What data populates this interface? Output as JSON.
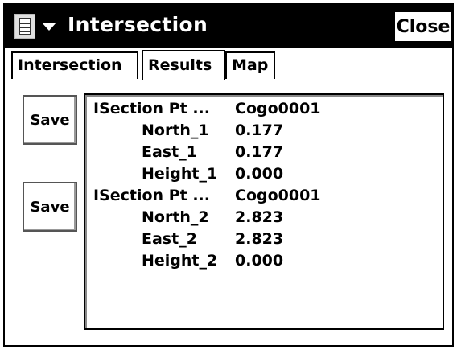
{
  "window": {
    "title": "Intersection",
    "close_label": "Close",
    "menu_icon": "document-menu-icon"
  },
  "tabs": [
    {
      "label": "Intersection",
      "active": false
    },
    {
      "label": "Results",
      "active": true
    },
    {
      "label": "Map",
      "active": false
    }
  ],
  "buttons": {
    "save_1": "Save",
    "save_2": "Save"
  },
  "results": [
    {
      "label": "ISection Pt ...",
      "value": "Cogo0001"
    },
    {
      "label": "North_1",
      "value": "0.177"
    },
    {
      "label": "East_1",
      "value": "0.177"
    },
    {
      "label": "Height_1",
      "value": "0.000"
    },
    {
      "label": "ISection Pt ...",
      "value": "Cogo0001"
    },
    {
      "label": "North_2",
      "value": "2.823"
    },
    {
      "label": "East_2",
      "value": "2.823"
    },
    {
      "label": "Height_2",
      "value": "0.000"
    }
  ]
}
